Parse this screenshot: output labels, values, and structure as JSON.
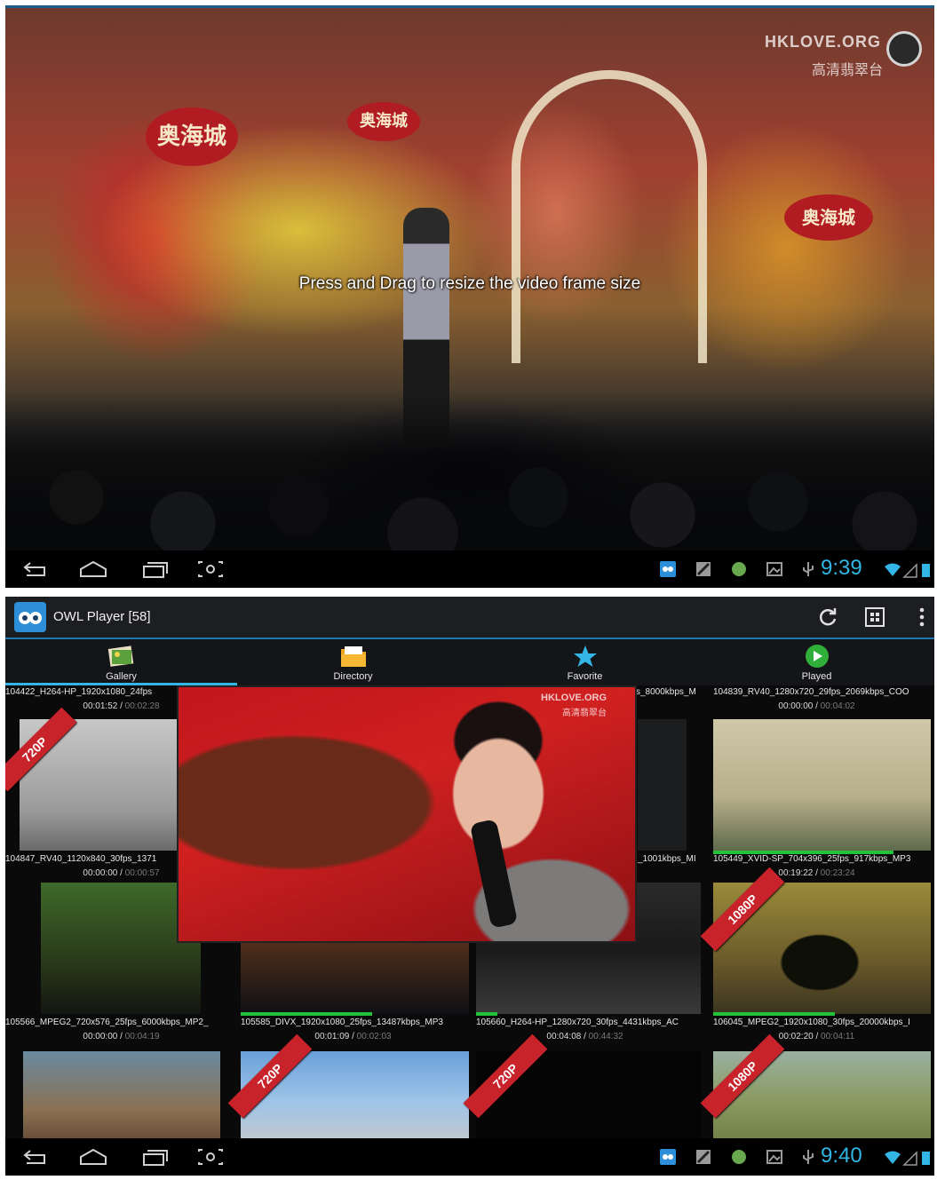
{
  "top": {
    "video": {
      "hint": "Press and Drag to resize the video frame size",
      "watermark": "HKLOVE.ORG",
      "watermark_sub": "高清翡翠台",
      "sign_left": "奥海城",
      "sign_mid": "奥海城",
      "sign_right": "奥海城"
    },
    "status": {
      "time": "9:39"
    }
  },
  "bottom": {
    "app": {
      "title": "OWL Player [58]"
    },
    "tabs": [
      {
        "label": "Gallery"
      },
      {
        "label": "Directory"
      },
      {
        "label": "Favorite"
      },
      {
        "label": "Played"
      }
    ],
    "popup": {
      "watermark": "HKLOVE.ORG",
      "watermark_sub": "高清翡翠台"
    },
    "rows": [
      [
        {
          "name": "104422_H264-HP_1920x1080_24fps",
          "played": "00:01:52",
          "total": "00:02:28"
        },
        {
          "name": "",
          "played": "",
          "total": ""
        },
        {
          "name": "s_8000kbps_M",
          "played": "",
          "total": ""
        },
        {
          "name": "104839_RV40_1280x720_29fps_2069kbps_COO",
          "played": "00:00:00",
          "total": "00:04:02"
        }
      ],
      [
        {
          "name": "104847_RV40_1120x840_30fps_1371",
          "played": "00:00:00",
          "total": "00:00:57",
          "badge": "720P"
        },
        {
          "name": "",
          "played": "",
          "total": ""
        },
        {
          "name": "_1001kbps_MI",
          "played": "",
          "total": ""
        },
        {
          "name": "105449_XVID-SP_704x396_25fps_917kbps_MP3",
          "played": "00:19:22",
          "total": "00:23:24",
          "progress": 0.83
        }
      ],
      [
        {
          "name": "105566_MPEG2_720x576_25fps_6000kbps_MP2_",
          "played": "00:00:00",
          "total": "00:04:19"
        },
        {
          "name": "105585_DIVX_1920x1080_25fps_13487kbps_MP3",
          "played": "00:01:09",
          "total": "00:02:03",
          "progress": 0.56
        },
        {
          "name": "105660_H264-HP_1280x720_30fps_4431kbps_AC",
          "played": "00:04:08",
          "total": "00:44:32",
          "progress": 0.09
        },
        {
          "name": "106045_MPEG2_1920x1080_30fps_20000kbps_I",
          "played": "00:02:20",
          "total": "00:04:11",
          "progress": 0.56,
          "badge": "1080P"
        }
      ],
      [
        {
          "badge": ""
        },
        {
          "badge": "720P"
        },
        {
          "badge": "720P"
        },
        {
          "badge": "1080P"
        }
      ]
    ],
    "status": {
      "time": "9:40"
    }
  },
  "colors": {
    "accent": "#33b5e5",
    "badge": "#c8222a",
    "progress": "#22c23a"
  }
}
